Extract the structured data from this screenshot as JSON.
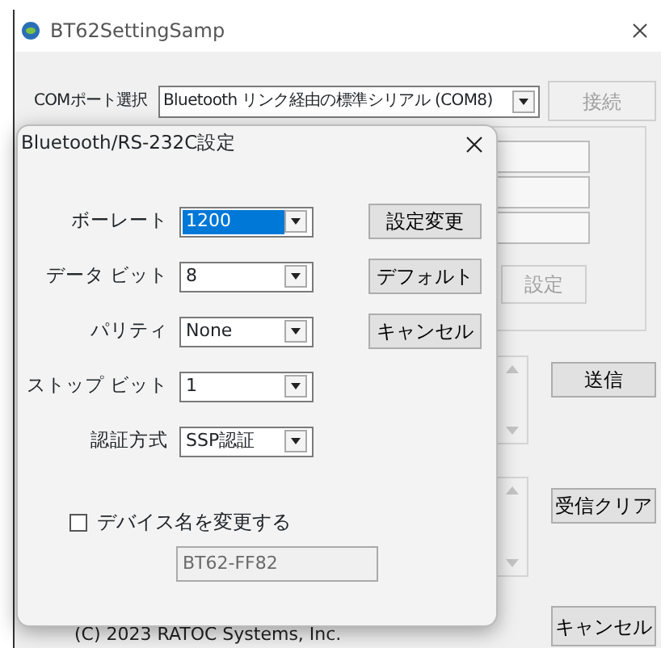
{
  "window": {
    "title": "BT62SettingSamp"
  },
  "com_port": {
    "label": "COMポート選択",
    "value": "Bluetooth リンク経由の標準シリアル (COM8)"
  },
  "connect_button": {
    "label": "接続",
    "disabled": true
  },
  "settings_button": {
    "label": "設定",
    "disabled": true
  },
  "send_button": {
    "label": "送信"
  },
  "clear_button": {
    "label": "受信クリア"
  },
  "cancel_button": {
    "label": "キャンセル"
  },
  "copyright": "(C) 2023 RATOC Systems, Inc.",
  "dialog": {
    "title": "Bluetooth/RS-232C設定",
    "fields": [
      {
        "label": "ボーレート",
        "value": "1200",
        "selected": true
      },
      {
        "label": "データ ビット",
        "value": "8",
        "selected": false
      },
      {
        "label": "パリティ",
        "value": "None",
        "selected": false
      },
      {
        "label": "ストップ ビット",
        "value": "1",
        "selected": false
      },
      {
        "label": "認証方式",
        "value": "SSP認証",
        "selected": false
      }
    ],
    "buttons": [
      "設定変更",
      "デフォルト",
      "キャンセル"
    ],
    "rename": {
      "label": "デバイス名を変更する",
      "checked": false
    },
    "device_name": {
      "value": "BT62-FF82",
      "disabled": true
    }
  }
}
